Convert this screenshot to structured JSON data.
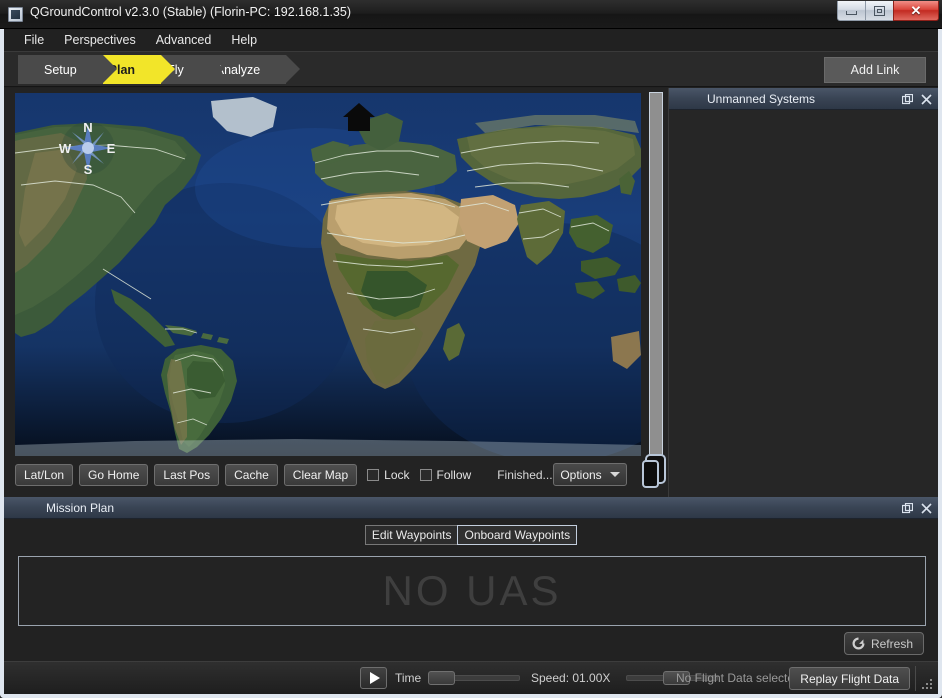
{
  "window": {
    "title": "QGroundControl v2.3.0 (Stable) (Florin-PC: 192.168.1.35)",
    "app_icon": "app-window-icon",
    "controls": {
      "minimize": "minimize-icon",
      "maximize": "maximize-icon",
      "close": "close-icon"
    }
  },
  "menubar": {
    "items": [
      {
        "label": "File"
      },
      {
        "label": "Perspectives"
      },
      {
        "label": "Advanced"
      },
      {
        "label": "Help"
      }
    ]
  },
  "toolbar": {
    "breadcrumbs": [
      {
        "label": "Setup",
        "active": false
      },
      {
        "label": "Plan",
        "active": true
      },
      {
        "label": "Fly",
        "active": false
      },
      {
        "label": "Analyze",
        "active": false
      }
    ],
    "add_link_label": "Add Link",
    "active_color": "#f2e529"
  },
  "map": {
    "compass": {
      "north": "N",
      "west": "W",
      "east": "E",
      "south": "S"
    },
    "home_marker": "home-icon",
    "buttons": [
      {
        "label": "Lat/Lon"
      },
      {
        "label": "Go Home"
      },
      {
        "label": "Last Pos"
      },
      {
        "label": "Cache"
      },
      {
        "label": "Clear Map"
      }
    ],
    "checkboxes": [
      {
        "label": "Lock",
        "checked": false
      },
      {
        "label": "Follow",
        "checked": false
      }
    ],
    "status_text": "Finished.......",
    "options_label": "Options",
    "zoom_slider": {
      "name": "map-zoom-slider"
    }
  },
  "unmanned_systems": {
    "title": "Unmanned Systems",
    "float_icon": "float-icon",
    "close_icon": "close-icon"
  },
  "mission_plan": {
    "title": "Mission Plan",
    "float_icon": "float-icon",
    "close_icon": "close-icon",
    "tabs": [
      {
        "label": "Edit Waypoints",
        "selected": false
      },
      {
        "label": "Onboard Waypoints",
        "selected": true
      }
    ],
    "empty_text": "NO UAS",
    "refresh_label": "Refresh",
    "refresh_icon": "refresh-icon"
  },
  "statusbar": {
    "play_icon": "play-icon",
    "time_label": "Time",
    "speed_label": "Speed: 01.00X",
    "flight_data_status": "No Flight Data selected..",
    "replay_label": "Replay Flight Data",
    "grip_icon": "resize-grip-icon"
  }
}
